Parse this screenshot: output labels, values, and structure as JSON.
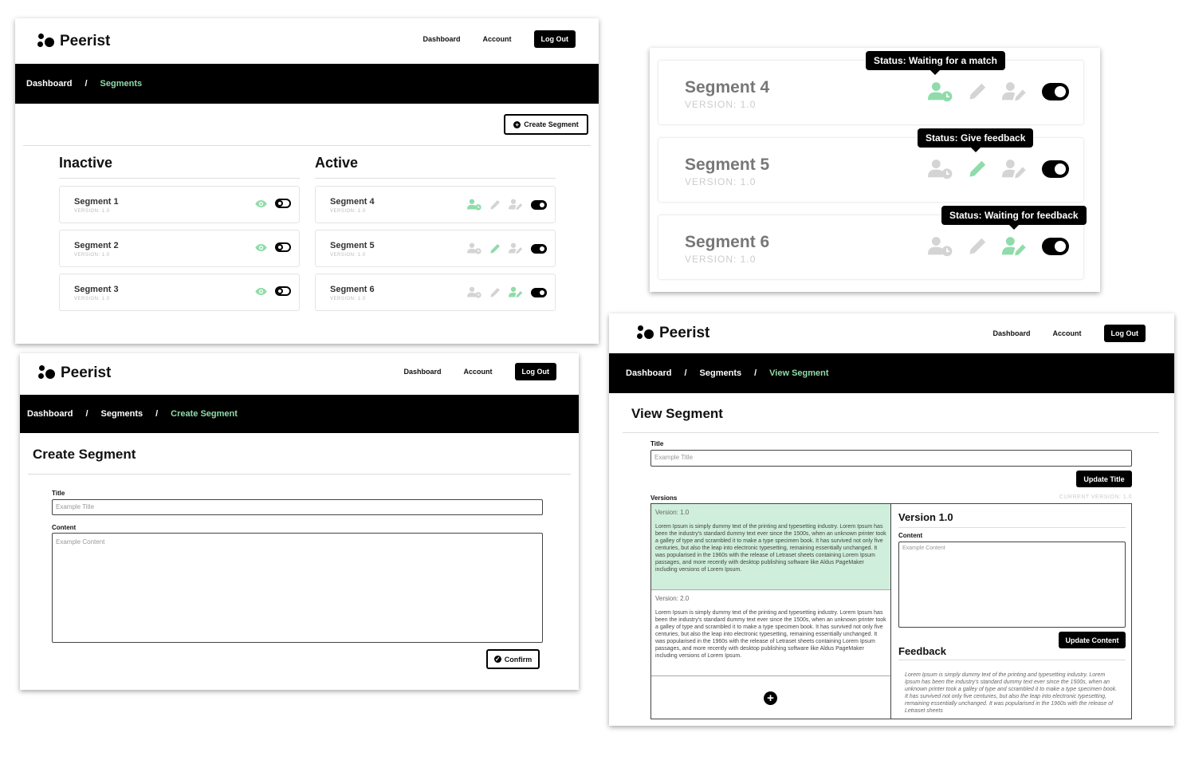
{
  "brand": "Peerist",
  "nav": {
    "dashboard": "Dashboard",
    "account": "Account",
    "logout": "Log Out"
  },
  "colors": {
    "accent": "#8fdcaa",
    "black": "#000000",
    "inactive_icon": "#d4d4d4"
  },
  "dashboard": {
    "crumb1": "Dashboard",
    "sep": "/",
    "crumb2": "Segments",
    "create_btn": "Create Segment",
    "inactive_title": "Inactive",
    "active_title": "Active",
    "inactive": [
      {
        "name": "Segment 1",
        "version": "VERSION: 1.0"
      },
      {
        "name": "Segment 2",
        "version": "VERSION: 1.0"
      },
      {
        "name": "Segment 3",
        "version": "VERSION: 1.0"
      }
    ],
    "active": [
      {
        "name": "Segment 4",
        "version": "VERSION: 1.0",
        "status": "waiting-match"
      },
      {
        "name": "Segment 5",
        "version": "VERSION: 1.0",
        "status": "give-feedback"
      },
      {
        "name": "Segment 6",
        "version": "VERSION: 1.0",
        "status": "waiting-feedback"
      }
    ]
  },
  "zoom": {
    "cards": [
      {
        "name": "Segment 4",
        "version": "VERSION: 1.0",
        "tip": "Status: Waiting for a match"
      },
      {
        "name": "Segment 5",
        "version": "VERSION: 1.0",
        "tip": "Status: Give feedback"
      },
      {
        "name": "Segment 6",
        "version": "VERSION: 1.0",
        "tip": "Status: Waiting for feedback"
      }
    ]
  },
  "create": {
    "crumb1": "Dashboard",
    "sep": "/",
    "crumb2": "Segments",
    "crumb3": "Create Segment",
    "heading": "Create Segment",
    "title_label": "Title",
    "title_placeholder": "Example Title",
    "content_label": "Content",
    "content_placeholder": "Example Content",
    "confirm": "Confirm"
  },
  "view": {
    "crumb1": "Dashboard",
    "sep": "/",
    "crumb2": "Segments",
    "crumb3": "View Segment",
    "heading": "View Segment",
    "title_label": "Title",
    "title_placeholder": "Example Title",
    "update_title": "Update Title",
    "versions_label": "Versions",
    "current_version": "CURRENT VERSION: 1.0",
    "versions": [
      {
        "label": "Version: 1.0",
        "text": "Lorem Ipsum is simply dummy text of the printing and typesetting industry. Lorem Ipsum has been the industry's standard dummy text ever since the 1500s, when an unknown printer took a galley of type and scrambled it to make a type specimen book. It has survived not only five centuries, but also the leap into electronic typesetting, remaining essentially unchanged. It was popularised in the 1960s with the release of Letraset sheets containing Lorem Ipsum passages, and more recently with desktop publishing software like Aldus PageMaker including versions of Lorem Ipsum."
      },
      {
        "label": "Version: 2.0",
        "text": "Lorem Ipsum is simply dummy text of the printing and typesetting industry. Lorem Ipsum has been the industry's standard dummy text ever since the 1500s, when an unknown printer took a galley of type and scrambled it to make a type specimen book. It has survived not only five centuries, but also the leap into electronic typesetting, remaining essentially unchanged. It was popularised in the 1960s with the release of Letraset sheets containing Lorem Ipsum passages, and more recently with desktop publishing software like Aldus PageMaker including versions of Lorem Ipsum."
      }
    ],
    "version_heading": "Version 1.0",
    "content_label": "Content",
    "content_placeholder": "Example Content",
    "update_content": "Update Content",
    "feedback_heading": "Feedback",
    "feedback_text": "Lorem Ipsum is simply dummy text of the printing and typesetting industry. Lorem Ipsum has been the industry's standard dummy text ever since the 1500s, when an unknown printer took a galley of type and scrambled it to make a type specimen book. It has survived not only five centuries, but also the leap into electronic typesetting, remaining essentially unchanged. It was popularised in the 1960s with the release of Letraset sheets"
  }
}
